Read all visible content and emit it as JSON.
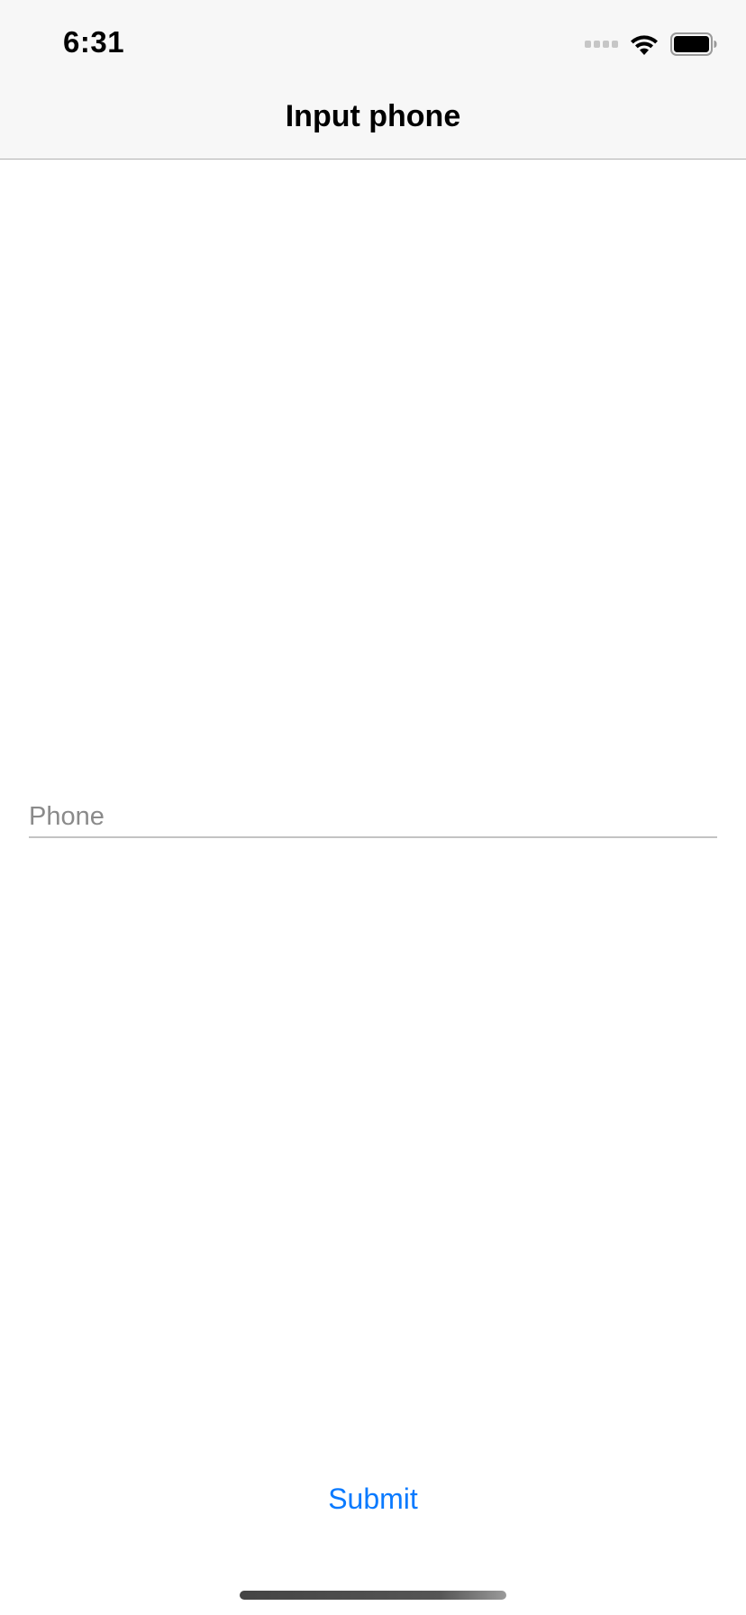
{
  "status_bar": {
    "time": "6:31",
    "signal_icon": "cellular-signal-icon",
    "wifi_icon": "wifi-icon",
    "battery_icon": "battery-icon"
  },
  "nav": {
    "title": "Input phone"
  },
  "form": {
    "phone_value": "",
    "phone_placeholder": "Phone",
    "submit_label": "Submit"
  },
  "colors": {
    "accent": "#0a7aff",
    "bar_background": "#f7f7f7",
    "separator": "#b2b2b2",
    "placeholder": "#8a8a8a"
  }
}
